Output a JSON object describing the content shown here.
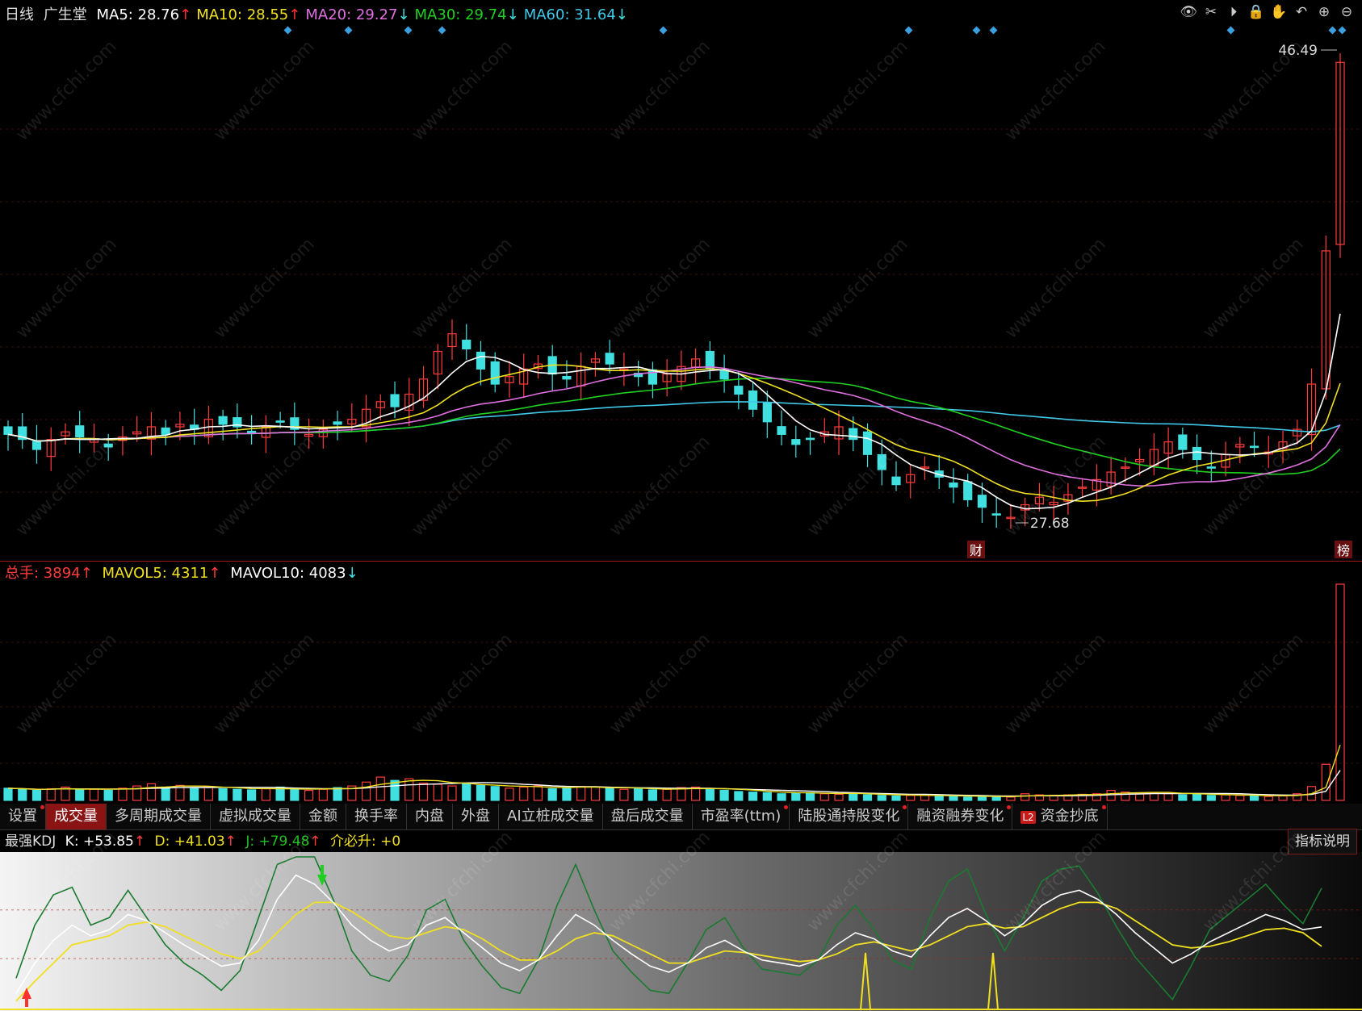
{
  "main": {
    "period": "日线",
    "stock_name": "广生堂",
    "ma": [
      {
        "label": "MA5: 28.76",
        "arrow": "↑",
        "color": "#ffffff",
        "arrow_color": "#ff3030"
      },
      {
        "label": "MA10: 28.55",
        "arrow": "↑",
        "color": "#f0e020",
        "arrow_color": "#ff3030"
      },
      {
        "label": "MA20: 29.27",
        "arrow": "↓",
        "color": "#e070e0",
        "arrow_color": "#40e0e0"
      },
      {
        "label": "MA30: 29.74",
        "arrow": "↓",
        "color": "#20d020",
        "arrow_color": "#40e0e0"
      },
      {
        "label": "MA60: 31.64",
        "arrow": "↓",
        "color": "#40c8e8",
        "arrow_color": "#40e0e0"
      }
    ],
    "high_label": "46.49",
    "low_label": "27.68",
    "marker_cai": "财",
    "marker_bang": "榜"
  },
  "toolbar_icons": [
    "eye-icon",
    "scissors-icon",
    "play-icon",
    "lock-icon",
    "hand-icon",
    "undo-icon",
    "zoom-in-icon",
    "zoom-out-icon"
  ],
  "volume": {
    "total_label": "总手: 3894",
    "total_arrow": "↑",
    "mavol5_label": "MAVOL5: 4311",
    "mavol5_arrow": "↑",
    "mavol10_label": "MAVOL10: 4083",
    "mavol10_arrow": "↓"
  },
  "tabs": [
    {
      "label": "设置",
      "dot": true,
      "active": false
    },
    {
      "label": "成交量",
      "dot": false,
      "active": true
    },
    {
      "label": "多周期成交量",
      "dot": false,
      "active": false
    },
    {
      "label": "虚拟成交量",
      "dot": false,
      "active": false
    },
    {
      "label": "金额",
      "dot": false,
      "active": false
    },
    {
      "label": "换手率",
      "dot": false,
      "active": false
    },
    {
      "label": "内盘",
      "dot": false,
      "active": false
    },
    {
      "label": "外盘",
      "dot": false,
      "active": false
    },
    {
      "label": "AI立桩成交量",
      "dot": false,
      "active": false
    },
    {
      "label": "盘后成交量",
      "dot": false,
      "active": false
    },
    {
      "label": "市盈率(ttm)",
      "dot": true,
      "active": false
    },
    {
      "label": "陆股通持股变化",
      "dot": true,
      "active": false
    },
    {
      "label": "融资融券变化",
      "dot": true,
      "active": false
    },
    {
      "label": "资金抄底",
      "dot": true,
      "active": false,
      "badge": "L2"
    }
  ],
  "kdj": {
    "name": "最强KDJ",
    "k_label": "K: +53.85",
    "k_arrow": "↑",
    "d_label": "D: +41.03",
    "d_arrow": "↑",
    "j_label": "J: +79.48",
    "j_arrow": "↑",
    "extra_label": "介必升: +0",
    "help": "指标说明"
  },
  "watermark": "www.cfchi.com",
  "colors": {
    "up": "#ff3c3c",
    "down": "#40e0e0",
    "ma5": "#ffffff",
    "ma10": "#f0e020",
    "ma20": "#e070e0",
    "ma30": "#20d020",
    "ma60": "#40c8e8"
  },
  "chart_data": {
    "type": "candlestick",
    "price_high": 46.49,
    "price_low": 27.68,
    "closes": [
      31.2,
      31.0,
      30.6,
      31.0,
      31.3,
      31.1,
      31.0,
      30.7,
      31.1,
      31.3,
      31.5,
      31.2,
      31.6,
      31.4,
      31.8,
      31.6,
      31.5,
      31.3,
      31.5,
      31.7,
      31.4,
      31.2,
      31.4,
      31.6,
      31.8,
      32.2,
      32.5,
      32.3,
      32.8,
      33.4,
      34.5,
      35.2,
      34.6,
      33.8,
      33.2,
      33.5,
      33.8,
      34.0,
      33.6,
      33.4,
      33.9,
      34.2,
      34.0,
      33.8,
      33.5,
      33.2,
      33.6,
      33.9,
      34.2,
      33.8,
      33.4,
      32.8,
      32.2,
      31.7,
      31.2,
      30.8,
      31.0,
      31.3,
      31.5,
      31.0,
      30.4,
      29.8,
      29.2,
      29.6,
      29.9,
      29.5,
      29.1,
      28.6,
      28.3,
      28.0,
      27.9,
      28.4,
      28.7,
      28.5,
      28.8,
      29.1,
      29.4,
      29.7,
      29.9,
      30.2,
      30.6,
      30.9,
      30.6,
      30.2,
      29.9,
      30.4,
      30.8,
      30.7,
      30.5,
      30.9,
      31.4,
      33.2,
      38.5,
      46.0
    ],
    "volumes": [
      2.2,
      2.0,
      1.8,
      2.1,
      2.4,
      1.9,
      2.0,
      1.8,
      2.2,
      2.6,
      3.0,
      2.4,
      2.7,
      2.2,
      2.5,
      2.1,
      2.0,
      1.9,
      2.1,
      2.4,
      2.0,
      1.8,
      2.0,
      2.3,
      2.6,
      3.3,
      4.2,
      3.6,
      3.9,
      3.1,
      2.9,
      2.6,
      3.0,
      2.7,
      2.5,
      2.2,
      2.4,
      2.6,
      2.1,
      2.3,
      2.5,
      2.4,
      2.2,
      2.0,
      2.1,
      1.9,
      2.0,
      2.3,
      2.4,
      2.0,
      1.8,
      1.6,
      1.5,
      1.4,
      1.2,
      1.3,
      1.4,
      1.2,
      1.1,
      1.3,
      1.0,
      0.9,
      0.8,
      0.9,
      1.0,
      0.8,
      0.7,
      0.6,
      0.7,
      0.8,
      0.6,
      1.2,
      1.0,
      0.9,
      1.0,
      1.1,
      1.2,
      1.8,
      1.5,
      1.3,
      1.4,
      1.2,
      1.0,
      1.1,
      0.9,
      1.0,
      0.9,
      0.8,
      0.7,
      0.8,
      1.2,
      2.5,
      6.5,
      38.94
    ],
    "kdj_k": [
      10,
      30,
      45,
      55,
      48,
      52,
      62,
      58,
      50,
      42,
      35,
      28,
      30,
      45,
      72,
      88,
      82,
      70,
      55,
      45,
      38,
      42,
      55,
      60,
      50,
      40,
      30,
      25,
      32,
      48,
      62,
      55,
      45,
      36,
      28,
      24,
      30,
      40,
      45,
      38,
      32,
      30,
      28,
      32,
      42,
      50,
      46,
      38,
      34,
      48,
      60,
      66,
      58,
      48,
      56,
      68,
      75,
      78,
      72,
      62,
      50,
      40,
      30,
      36,
      44,
      50,
      56,
      62,
      58,
      52,
      53.85
    ],
    "kdj_d": [
      5,
      18,
      30,
      42,
      45,
      48,
      55,
      57,
      54,
      48,
      42,
      36,
      33,
      38,
      50,
      62,
      70,
      70,
      64,
      56,
      48,
      46,
      50,
      54,
      52,
      46,
      38,
      32,
      32,
      38,
      46,
      50,
      48,
      42,
      36,
      30,
      30,
      34,
      38,
      37,
      35,
      33,
      31,
      32,
      36,
      42,
      44,
      41,
      38,
      42,
      48,
      54,
      56,
      53,
      54,
      60,
      66,
      70,
      70,
      66,
      58,
      50,
      42,
      40,
      41,
      44,
      48,
      52,
      53,
      50,
      41.03
    ],
    "kdj_j": [
      20,
      55,
      75,
      80,
      55,
      60,
      78,
      60,
      42,
      30,
      22,
      12,
      25,
      60,
      95,
      100,
      100,
      72,
      38,
      22,
      18,
      35,
      65,
      72,
      45,
      28,
      14,
      10,
      32,
      68,
      95,
      65,
      38,
      24,
      12,
      10,
      30,
      52,
      60,
      40,
      26,
      24,
      22,
      32,
      55,
      68,
      52,
      32,
      26,
      60,
      84,
      92,
      62,
      38,
      60,
      84,
      92,
      94,
      76,
      54,
      34,
      20,
      6,
      28,
      52,
      62,
      72,
      82,
      68,
      56,
      79.48
    ]
  }
}
